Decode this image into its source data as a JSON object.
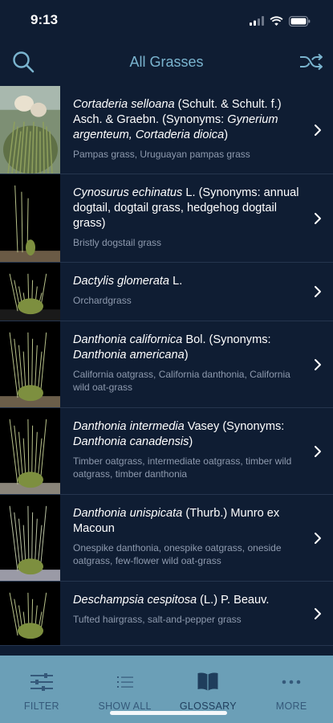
{
  "status": {
    "time": "9:13"
  },
  "nav": {
    "title": "All Grasses",
    "left_icon": "search-icon",
    "right_icon": "shuffle-icon",
    "accent": "#7ab4cf"
  },
  "list": [
    {
      "sci_parts": [
        {
          "t": "Cortaderia selloana",
          "i": true
        },
        {
          "t": " (Schult. & Schult. f.) Asch. & Graebn. (Synonyms: ",
          "i": false
        },
        {
          "t": "Gynerium argenteum, Cortaderia dioica",
          "i": true
        },
        {
          "t": ")",
          "i": false
        }
      ],
      "common": "Pampas grass, Uruguayan pampas grass"
    },
    {
      "sci_parts": [
        {
          "t": "Cynosurus echinatus",
          "i": true
        },
        {
          "t": " L. (Synonyms: annual dogtail, dogtail grass, hedgehog dogtail grass)",
          "i": false
        }
      ],
      "common": "Bristly dogstail grass"
    },
    {
      "sci_parts": [
        {
          "t": "Dactylis glomerata",
          "i": true
        },
        {
          "t": " L.",
          "i": false
        }
      ],
      "common": "Orchardgrass"
    },
    {
      "sci_parts": [
        {
          "t": "Danthonia californica",
          "i": true
        },
        {
          "t": " Bol. (Synonyms: ",
          "i": false
        },
        {
          "t": "Danthonia americana",
          "i": true
        },
        {
          "t": ")",
          "i": false
        }
      ],
      "common": "California oatgrass, California danthonia, California wild oat-grass"
    },
    {
      "sci_parts": [
        {
          "t": "Danthonia intermedia",
          "i": true
        },
        {
          "t": " Vasey (Synonyms: ",
          "i": false
        },
        {
          "t": "Danthonia canadensis",
          "i": true
        },
        {
          "t": ")",
          "i": false
        }
      ],
      "common": "Timber oatgrass, intermediate oatgrass, timber wild oatgrass, timber danthonia"
    },
    {
      "sci_parts": [
        {
          "t": "Danthonia unispicata",
          "i": true
        },
        {
          "t": " (Thurb.) Munro ex Macoun",
          "i": false
        }
      ],
      "common": "Onespike danthonia, onespike oatgrass, oneside oatgrass, few-flower wild oat-grass"
    },
    {
      "sci_parts": [
        {
          "t": "Deschampsia cespitosa",
          "i": true
        },
        {
          "t": " (L.) P. Beauv.",
          "i": false
        }
      ],
      "common": "Tufted hairgrass, salt-and-pepper grass"
    }
  ],
  "tabs": [
    {
      "label": "FILTER",
      "icon": "sliders-icon"
    },
    {
      "label": "SHOW ALL",
      "icon": "list-icon"
    },
    {
      "label": "GLOSSARY",
      "icon": "book-icon"
    },
    {
      "label": "MORE",
      "icon": "more-dots-icon"
    }
  ],
  "colors": {
    "background": "#0f1d33",
    "tab_bar": "#6b9fb7",
    "tab_label": "#35597a"
  }
}
